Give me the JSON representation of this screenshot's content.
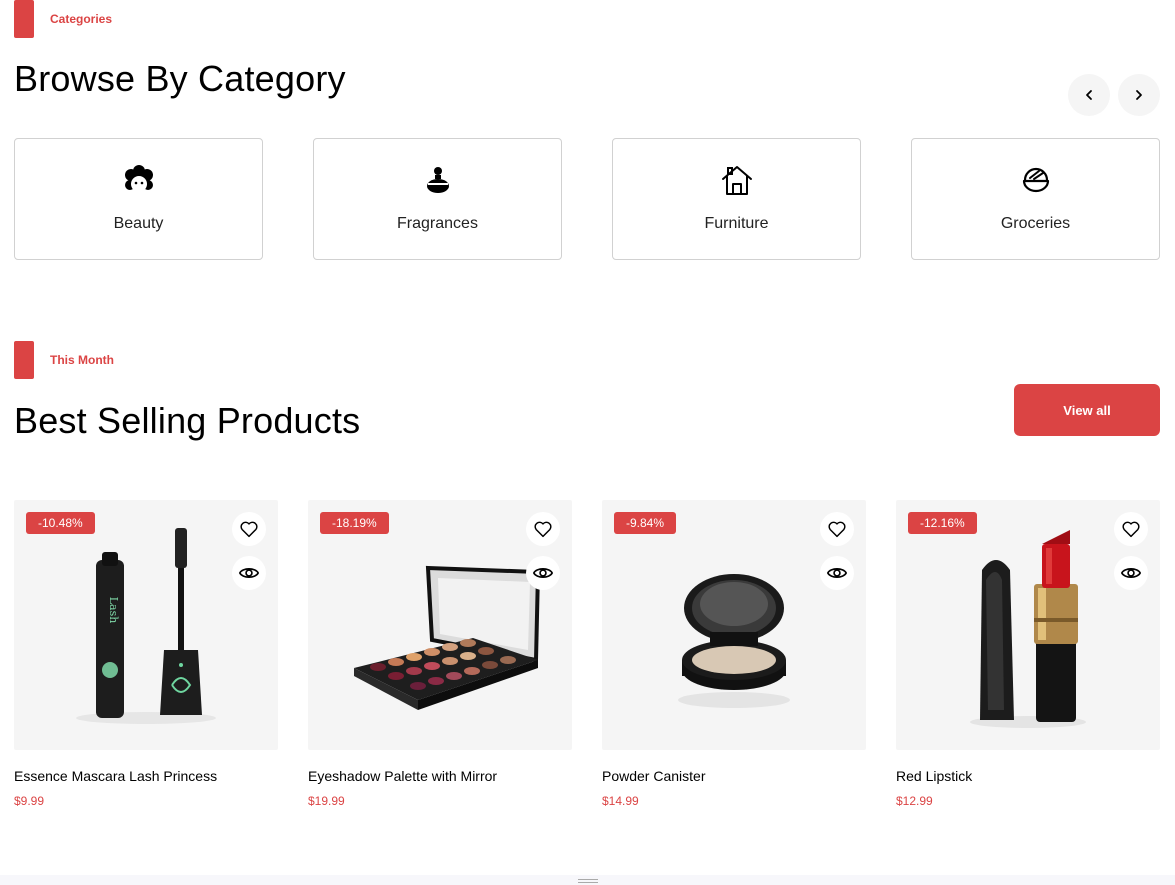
{
  "categories_section": {
    "eyebrow": "Categories",
    "title": "Browse By Category",
    "items": [
      {
        "label": "Beauty",
        "icon": "beauty-face-icon"
      },
      {
        "label": "Fragrances",
        "icon": "perfume-bottle-icon"
      },
      {
        "label": "Furniture",
        "icon": "home-icon"
      },
      {
        "label": "Groceries",
        "icon": "grocery-bowl-icon"
      }
    ]
  },
  "products_section": {
    "eyebrow": "This Month",
    "title": "Best Selling Products",
    "view_all_label": "View all",
    "products": [
      {
        "name": "Essence Mascara Lash Princess",
        "price": "$9.99",
        "discount": "-10.48%"
      },
      {
        "name": "Eyeshadow Palette with Mirror",
        "price": "$19.99",
        "discount": "-18.19%"
      },
      {
        "name": "Powder Canister",
        "price": "$14.99",
        "discount": "-9.84%"
      },
      {
        "name": "Red Lipstick",
        "price": "$12.99",
        "discount": "-12.16%"
      }
    ]
  },
  "colors": {
    "accent": "#db4444",
    "card_bg": "#f5f5f5",
    "border": "#d1d1d1"
  }
}
